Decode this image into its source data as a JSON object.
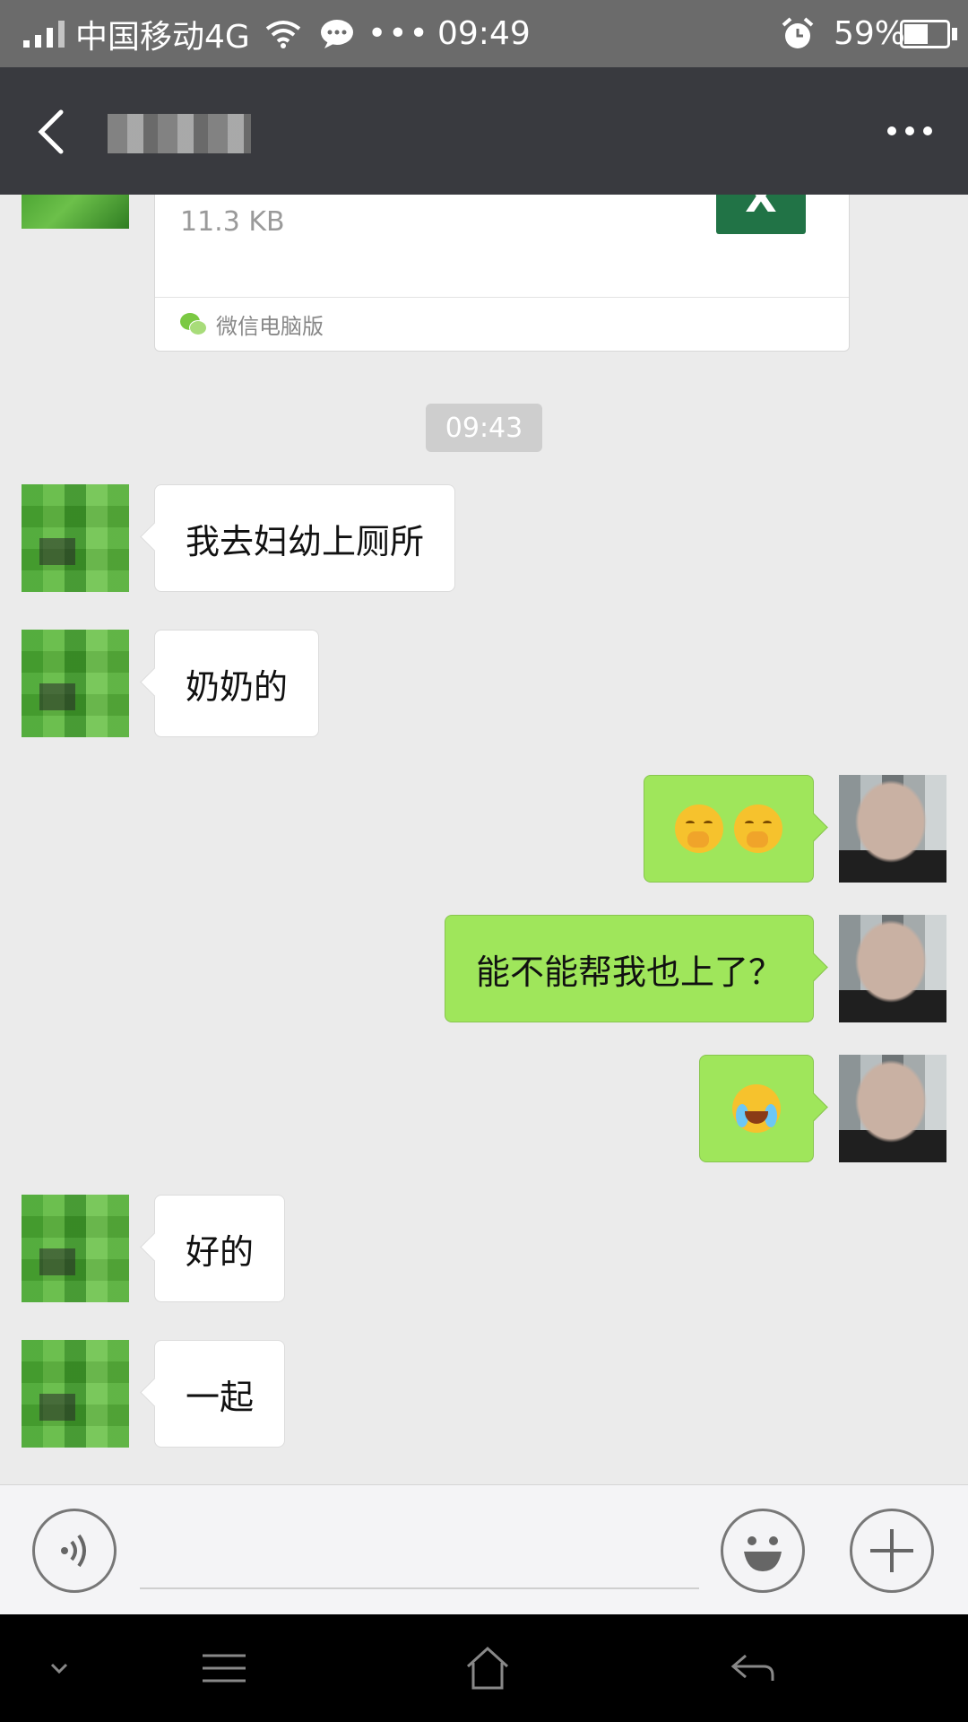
{
  "status_bar": {
    "carrier": "中国移动4G",
    "more": "•••",
    "time": "09:49",
    "battery_percent": "59%",
    "battery_level": 0.59
  },
  "header": {
    "contact_name": "",
    "back_icon": "chevron-left-icon",
    "more_icon": "more-dots-icon"
  },
  "file_card": {
    "size": "11.3 KB",
    "file_icon_letter": "X",
    "source": "微信电脑版"
  },
  "chat": {
    "timestamp": "09:43",
    "messages": [
      {
        "side": "left",
        "type": "text",
        "text": "我去妇幼上厕所"
      },
      {
        "side": "left",
        "type": "text",
        "text": "奶奶的"
      },
      {
        "side": "right",
        "type": "emoji",
        "emoji": "hand-over-mouth-emoji",
        "count": 2
      },
      {
        "side": "right",
        "type": "text",
        "text": "能不能帮我也上了？"
      },
      {
        "side": "right",
        "type": "emoji",
        "emoji": "loudly-crying-face-emoji",
        "count": 1
      },
      {
        "side": "left",
        "type": "text",
        "text": "好的"
      },
      {
        "side": "left",
        "type": "text",
        "text": "一起"
      }
    ]
  },
  "input_bar": {
    "voice_icon": "voice-icon",
    "emoji_icon": "emoji-icon",
    "plus_icon": "plus-icon",
    "input_value": ""
  },
  "nav_bar": {
    "icons": [
      "chevron-down-icon",
      "menu-icon",
      "home-icon",
      "back-icon"
    ]
  },
  "colors": {
    "header_bg": "#393a3f",
    "chat_bg": "#ebebeb",
    "sent_bubble": "#9fe65b",
    "received_bubble": "#ffffff"
  }
}
